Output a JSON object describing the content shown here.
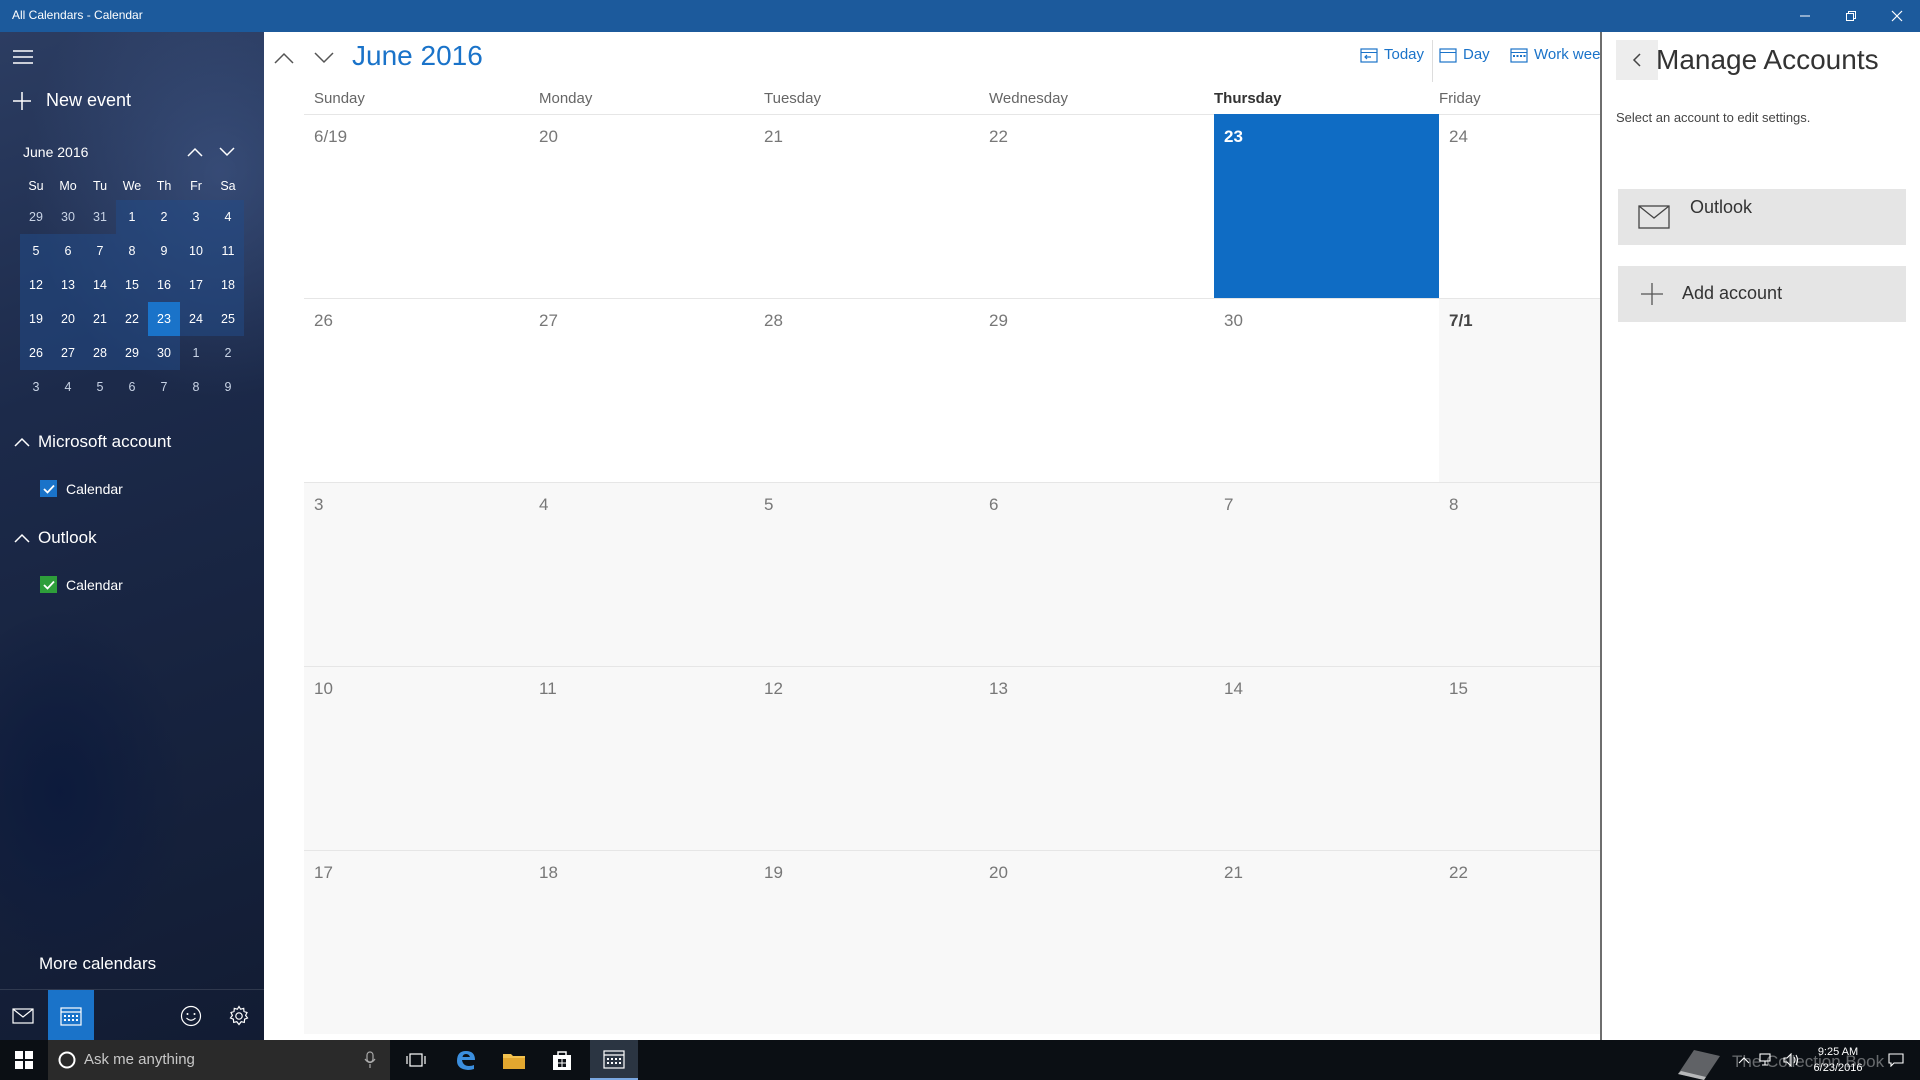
{
  "window": {
    "title": "All Calendars - Calendar"
  },
  "sidebar": {
    "new_event": "New event",
    "mini_calendar": {
      "title": "June 2016",
      "weekdays": [
        "Su",
        "Mo",
        "Tu",
        "We",
        "Th",
        "Fr",
        "Sa"
      ],
      "weeks": [
        [
          "29",
          "30",
          "31",
          "1",
          "2",
          "3",
          "4"
        ],
        [
          "5",
          "6",
          "7",
          "8",
          "9",
          "10",
          "11"
        ],
        [
          "12",
          "13",
          "14",
          "15",
          "16",
          "17",
          "18"
        ],
        [
          "19",
          "20",
          "21",
          "22",
          "23",
          "24",
          "25"
        ],
        [
          "26",
          "27",
          "28",
          "29",
          "30",
          "1",
          "2"
        ],
        [
          "3",
          "4",
          "5",
          "6",
          "7",
          "8",
          "9"
        ]
      ],
      "selected": "23"
    },
    "accounts": [
      {
        "name": "Microsoft account",
        "calendar": "Calendar",
        "checkbox_color": "#1a73c9"
      },
      {
        "name": "Outlook",
        "calendar": "Calendar",
        "checkbox_color": "#2e9e3a"
      }
    ],
    "more_calendars": "More calendars"
  },
  "header": {
    "month_title": "June 2016",
    "views": {
      "today": "Today",
      "day": "Day",
      "work_week": "Work week"
    }
  },
  "calendar": {
    "day_headers": [
      "Sunday",
      "Monday",
      "Tuesday",
      "Wednesday",
      "Thursday",
      "Friday"
    ],
    "today_column": "Thursday",
    "weeks": [
      [
        "6/19",
        "20",
        "21",
        "22",
        "23",
        "24"
      ],
      [
        "26",
        "27",
        "28",
        "29",
        "30",
        "7/1"
      ],
      [
        "3",
        "4",
        "5",
        "6",
        "7",
        "8"
      ],
      [
        "10",
        "11",
        "12",
        "13",
        "14",
        "15"
      ],
      [
        "17",
        "18",
        "19",
        "20",
        "21",
        "22"
      ]
    ],
    "today": "23",
    "accent": "#0f6cc4"
  },
  "panel": {
    "title": "Manage Accounts",
    "subtitle": "Select an account to edit settings.",
    "accounts": [
      "Outlook"
    ],
    "add_account": "Add account"
  },
  "taskbar": {
    "search_placeholder": "Ask me anything",
    "time": "9:25 AM",
    "date": "6/23/2016",
    "watermark": "The Collection Book"
  }
}
